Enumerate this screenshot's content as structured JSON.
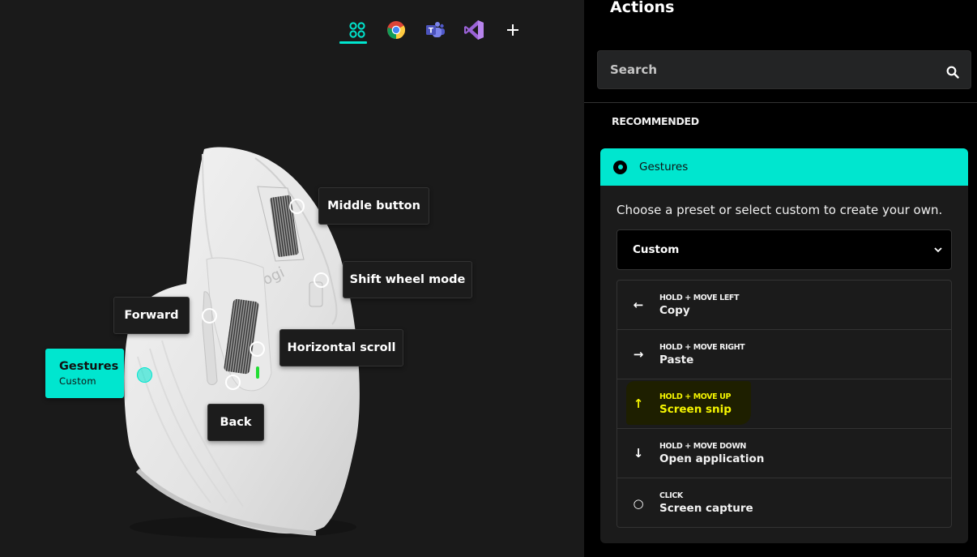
{
  "app_tabs": [
    {
      "name": "all-apps",
      "icon": "grid-icon",
      "active": true
    },
    {
      "name": "chrome",
      "icon": "chrome-icon"
    },
    {
      "name": "teams",
      "icon": "teams-icon"
    },
    {
      "name": "visual-studio",
      "icon": "visual-studio-icon"
    },
    {
      "name": "add-app",
      "icon": "plus-icon"
    }
  ],
  "mouse": {
    "logo_text": "logi",
    "callouts": {
      "middle_button": "Middle button",
      "shift_wheel_mode": "Shift wheel mode",
      "forward": "Forward",
      "horizontal_scroll": "Horizontal scroll",
      "back": "Back",
      "gestures": {
        "label": "Gestures",
        "sub": "Custom"
      }
    }
  },
  "panel": {
    "title": "Actions",
    "search_placeholder": "Search",
    "section_label": "RECOMMENDED",
    "card": {
      "title": "Gestures",
      "description": "Choose a preset or select custom to create your own.",
      "preset_selected": "Custom",
      "gestures": [
        {
          "icon": "arrow-left-icon",
          "glyph": "←",
          "trigger": "HOLD + MOVE LEFT",
          "action": "Copy"
        },
        {
          "icon": "arrow-right-icon",
          "glyph": "→",
          "trigger": "HOLD + MOVE RIGHT",
          "action": "Paste"
        },
        {
          "icon": "arrow-up-icon",
          "glyph": "↑",
          "trigger": "HOLD + MOVE UP",
          "action": "Screen snip",
          "highlighted": true
        },
        {
          "icon": "arrow-down-icon",
          "glyph": "↓",
          "trigger": "HOLD + MOVE DOWN",
          "action": "Open application"
        },
        {
          "icon": "click-circle-icon",
          "glyph": "○",
          "trigger": "CLICK",
          "action": "Screen capture"
        }
      ]
    }
  },
  "colors": {
    "accent": "#00e6cf",
    "highlight_text": "#f5f500",
    "panel_bg": "#000000",
    "canvas_bg": "#1a1a1a"
  }
}
